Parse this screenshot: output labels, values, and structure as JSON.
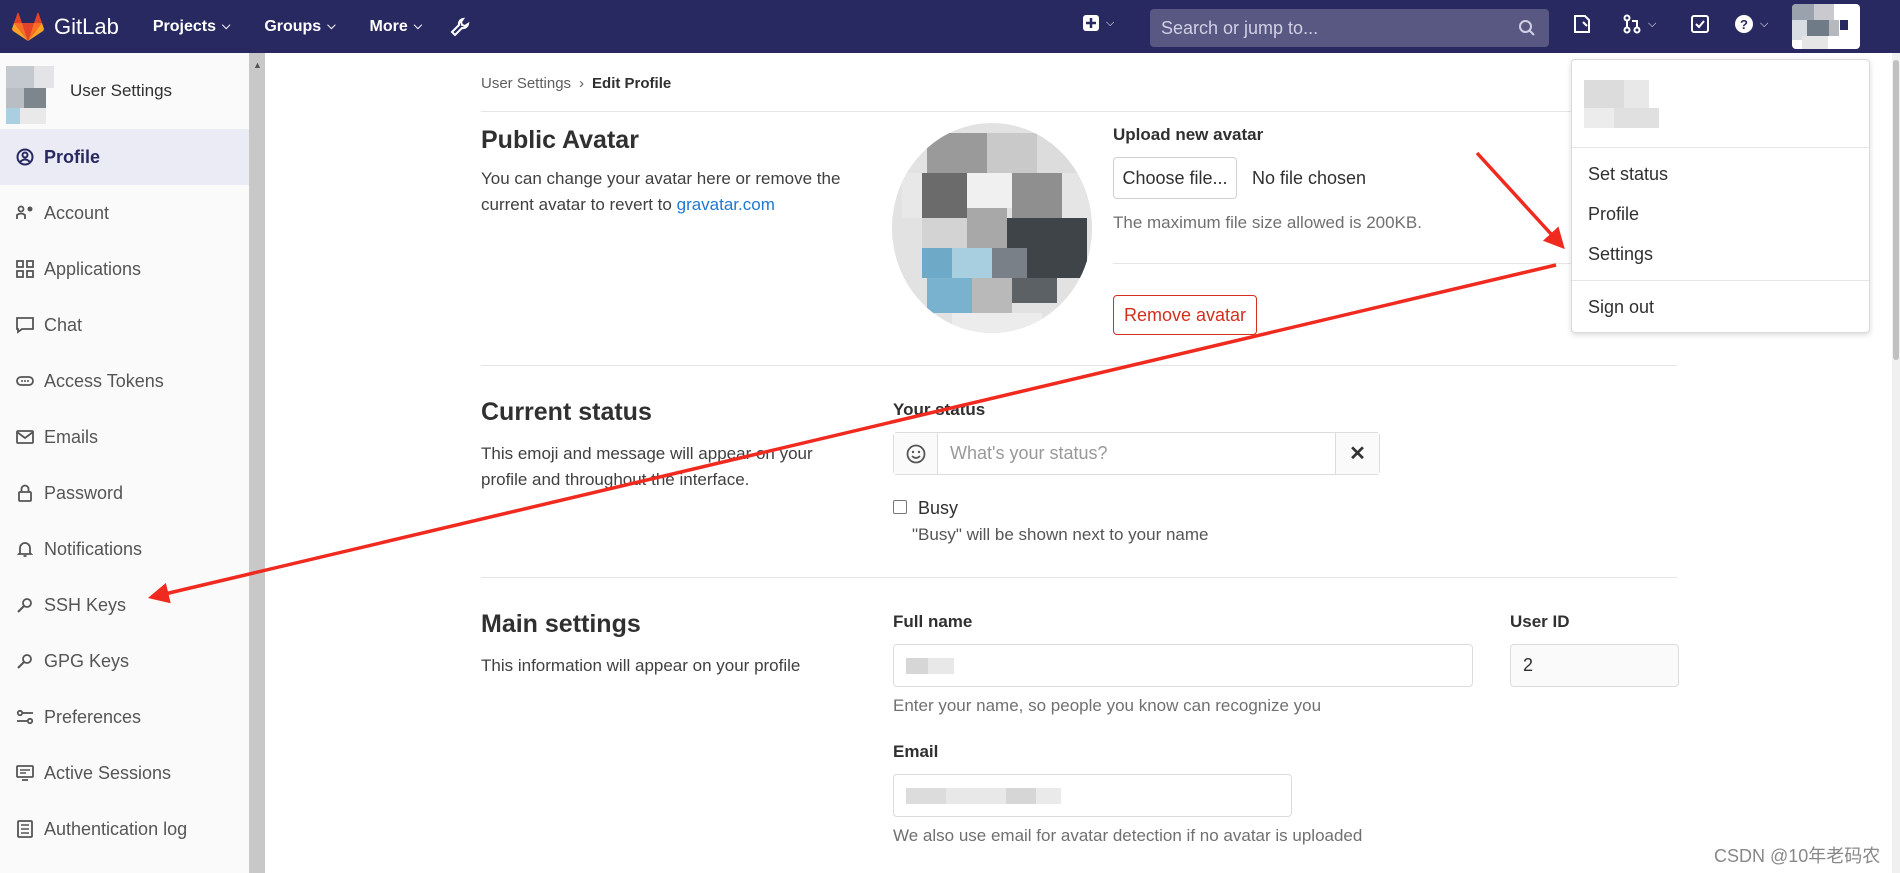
{
  "navbar": {
    "brand": "GitLab",
    "links": [
      "Projects",
      "Groups",
      "More"
    ],
    "search_placeholder": "Search or jump to..."
  },
  "sidebar": {
    "title": "User Settings",
    "items": [
      {
        "label": "Profile",
        "icon": "user-circle-icon"
      },
      {
        "label": "Account",
        "icon": "account-icon"
      },
      {
        "label": "Applications",
        "icon": "apps-grid-icon"
      },
      {
        "label": "Chat",
        "icon": "chat-icon"
      },
      {
        "label": "Access Tokens",
        "icon": "token-icon"
      },
      {
        "label": "Emails",
        "icon": "mail-icon"
      },
      {
        "label": "Password",
        "icon": "lock-icon"
      },
      {
        "label": "Notifications",
        "icon": "bell-icon"
      },
      {
        "label": "SSH Keys",
        "icon": "key-icon"
      },
      {
        "label": "GPG Keys",
        "icon": "key-icon"
      },
      {
        "label": "Preferences",
        "icon": "preferences-icon"
      },
      {
        "label": "Active Sessions",
        "icon": "monitor-icon"
      },
      {
        "label": "Authentication log",
        "icon": "log-icon"
      }
    ]
  },
  "breadcrumb": {
    "root": "User Settings",
    "current": "Edit Profile"
  },
  "avatar_section": {
    "title": "Public Avatar",
    "desc": "You can change your avatar here or remove the current avatar to revert to",
    "link": "gravatar.com",
    "upload_label": "Upload new avatar",
    "choose_button": "Choose file...",
    "no_file": "No file chosen",
    "max_size": "The maximum file size allowed is 200KB.",
    "remove_button": "Remove avatar"
  },
  "status_section": {
    "title": "Current status",
    "desc": "This emoji and message will appear on your profile and throughout the interface.",
    "label": "Your status",
    "placeholder": "What's your status?",
    "busy_label": "Busy",
    "busy_help": "\"Busy\" will be shown next to your name"
  },
  "main_settings": {
    "title": "Main settings",
    "desc": "This information will appear on your profile",
    "full_name_label": "Full name",
    "full_name_help": "Enter your name, so people you know can recognize you",
    "user_id_label": "User ID",
    "user_id_value": "2",
    "email_label": "Email",
    "email_help": "We also use email for avatar detection if no avatar is uploaded"
  },
  "user_dropdown": {
    "items": [
      "Set status",
      "Profile",
      "Settings"
    ],
    "sign_out": "Sign out"
  },
  "watermark": "CSDN @10年老码农",
  "colors": {
    "navbar": "#292961",
    "accent_red": "#d22f1d",
    "link_blue": "#1f78d1",
    "annotation_arrow": "#f02a1e"
  }
}
